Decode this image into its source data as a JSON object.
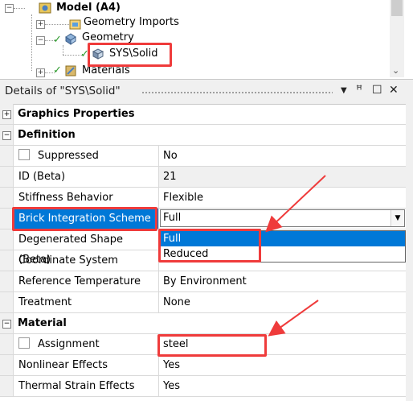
{
  "tree": {
    "model_label": "Model (A4)",
    "geometry_imports_label": "Geometry Imports",
    "geometry_label": "Geometry",
    "solid_label": "SYS\\Solid",
    "materials_label": "Materials"
  },
  "details": {
    "title": "Details of \"SYS\\Solid\"",
    "pin_icon": "pin-icon",
    "maximize_icon": "maximize-icon",
    "close_icon": "close-icon"
  },
  "sections": {
    "graphics": "Graphics Properties",
    "definition": "Definition",
    "material": "Material"
  },
  "rows": {
    "suppressed": {
      "name": "Suppressed",
      "value": "No"
    },
    "id": {
      "name": "ID (Beta)",
      "value": "21"
    },
    "stiffness": {
      "name": "Stiffness Behavior",
      "value": "Flexible"
    },
    "brick": {
      "name": "Brick Integration Scheme",
      "value": "Full"
    },
    "degenerated": {
      "name": "Degenerated Shape (Beta)"
    },
    "coord": {
      "name": "Coordinate System"
    },
    "reftemp": {
      "name": "Reference Temperature",
      "value": "By Environment"
    },
    "treatment": {
      "name": "Treatment",
      "value": "None"
    },
    "assignment": {
      "name": "Assignment",
      "value": "steel"
    },
    "nonlinear": {
      "name": "Nonlinear Effects",
      "value": "Yes"
    },
    "thermal": {
      "name": "Thermal Strain Effects",
      "value": "Yes"
    }
  },
  "dropdown": {
    "options": [
      "Full",
      "Reduced"
    ],
    "selected": "Full"
  },
  "colors": {
    "highlight": "#0078d7",
    "annotation_red": "#ef3b3b",
    "check_green": "#2a9a2a"
  }
}
